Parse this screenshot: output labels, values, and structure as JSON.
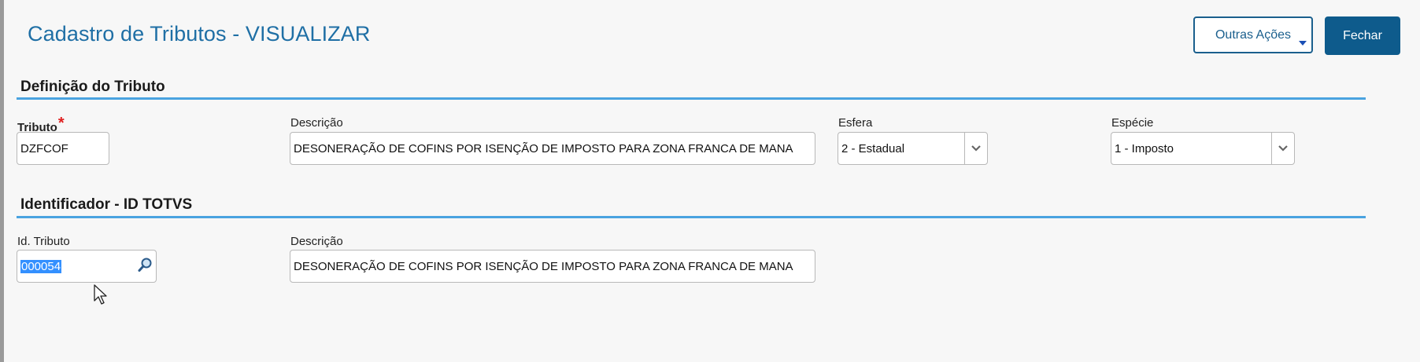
{
  "header": {
    "title": "Cadastro de Tributos - VISUALIZAR",
    "outras_acoes_label": "Outras Ações",
    "fechar_label": "Fechar"
  },
  "definicao": {
    "section_title": "Definição do Tributo",
    "tributo": {
      "label": "Tributo",
      "required_mark": "*",
      "value": "DZFCOF"
    },
    "descricao": {
      "label": "Descrição",
      "value": "DESONERAÇÃO DE COFINS POR ISENÇÃO DE IMPOSTO PARA ZONA FRANCA DE MANA"
    },
    "esfera": {
      "label": "Esfera",
      "value": "2 - Estadual"
    },
    "especie": {
      "label": "Espécie",
      "value": "1 - Imposto"
    }
  },
  "identificador": {
    "section_title": "Identificador - ID TOTVS",
    "id_tributo": {
      "label": "Id. Tributo",
      "value": "000054"
    },
    "descricao": {
      "label": "Descrição",
      "value": "DESONERAÇÃO DE COFINS POR ISENÇÃO DE IMPOSTO PARA ZONA FRANCA DE MANA"
    }
  },
  "colors": {
    "title": "#1f6fa5",
    "primary_button": "#0e5b8c",
    "section_line": "#4aa3e0",
    "required": "#e02020",
    "selection": "#3390ff"
  },
  "icons": {
    "outras_acoes_caret": "caret-down-icon",
    "select_arrow": "chevron-down-icon",
    "lookup": "magnifier-icon",
    "mouse_cursor": "arrow-cursor-icon"
  }
}
